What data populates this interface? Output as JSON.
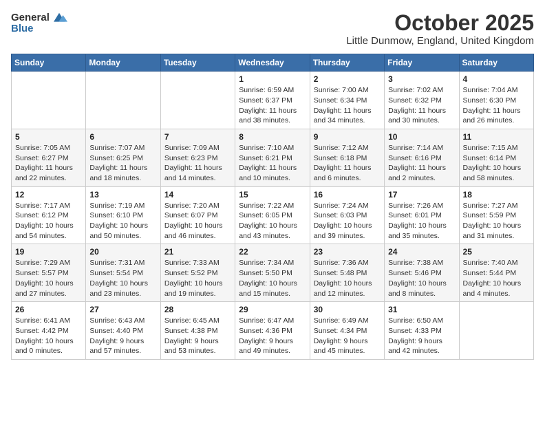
{
  "logo": {
    "general": "General",
    "blue": "Blue"
  },
  "header": {
    "month": "October 2025",
    "location": "Little Dunmow, England, United Kingdom"
  },
  "weekdays": [
    "Sunday",
    "Monday",
    "Tuesday",
    "Wednesday",
    "Thursday",
    "Friday",
    "Saturday"
  ],
  "weeks": [
    [
      {
        "day": "",
        "info": ""
      },
      {
        "day": "",
        "info": ""
      },
      {
        "day": "",
        "info": ""
      },
      {
        "day": "1",
        "info": "Sunrise: 6:59 AM\nSunset: 6:37 PM\nDaylight: 11 hours\nand 38 minutes."
      },
      {
        "day": "2",
        "info": "Sunrise: 7:00 AM\nSunset: 6:34 PM\nDaylight: 11 hours\nand 34 minutes."
      },
      {
        "day": "3",
        "info": "Sunrise: 7:02 AM\nSunset: 6:32 PM\nDaylight: 11 hours\nand 30 minutes."
      },
      {
        "day": "4",
        "info": "Sunrise: 7:04 AM\nSunset: 6:30 PM\nDaylight: 11 hours\nand 26 minutes."
      }
    ],
    [
      {
        "day": "5",
        "info": "Sunrise: 7:05 AM\nSunset: 6:27 PM\nDaylight: 11 hours\nand 22 minutes."
      },
      {
        "day": "6",
        "info": "Sunrise: 7:07 AM\nSunset: 6:25 PM\nDaylight: 11 hours\nand 18 minutes."
      },
      {
        "day": "7",
        "info": "Sunrise: 7:09 AM\nSunset: 6:23 PM\nDaylight: 11 hours\nand 14 minutes."
      },
      {
        "day": "8",
        "info": "Sunrise: 7:10 AM\nSunset: 6:21 PM\nDaylight: 11 hours\nand 10 minutes."
      },
      {
        "day": "9",
        "info": "Sunrise: 7:12 AM\nSunset: 6:18 PM\nDaylight: 11 hours\nand 6 minutes."
      },
      {
        "day": "10",
        "info": "Sunrise: 7:14 AM\nSunset: 6:16 PM\nDaylight: 11 hours\nand 2 minutes."
      },
      {
        "day": "11",
        "info": "Sunrise: 7:15 AM\nSunset: 6:14 PM\nDaylight: 10 hours\nand 58 minutes."
      }
    ],
    [
      {
        "day": "12",
        "info": "Sunrise: 7:17 AM\nSunset: 6:12 PM\nDaylight: 10 hours\nand 54 minutes."
      },
      {
        "day": "13",
        "info": "Sunrise: 7:19 AM\nSunset: 6:10 PM\nDaylight: 10 hours\nand 50 minutes."
      },
      {
        "day": "14",
        "info": "Sunrise: 7:20 AM\nSunset: 6:07 PM\nDaylight: 10 hours\nand 46 minutes."
      },
      {
        "day": "15",
        "info": "Sunrise: 7:22 AM\nSunset: 6:05 PM\nDaylight: 10 hours\nand 43 minutes."
      },
      {
        "day": "16",
        "info": "Sunrise: 7:24 AM\nSunset: 6:03 PM\nDaylight: 10 hours\nand 39 minutes."
      },
      {
        "day": "17",
        "info": "Sunrise: 7:26 AM\nSunset: 6:01 PM\nDaylight: 10 hours\nand 35 minutes."
      },
      {
        "day": "18",
        "info": "Sunrise: 7:27 AM\nSunset: 5:59 PM\nDaylight: 10 hours\nand 31 minutes."
      }
    ],
    [
      {
        "day": "19",
        "info": "Sunrise: 7:29 AM\nSunset: 5:57 PM\nDaylight: 10 hours\nand 27 minutes."
      },
      {
        "day": "20",
        "info": "Sunrise: 7:31 AM\nSunset: 5:54 PM\nDaylight: 10 hours\nand 23 minutes."
      },
      {
        "day": "21",
        "info": "Sunrise: 7:33 AM\nSunset: 5:52 PM\nDaylight: 10 hours\nand 19 minutes."
      },
      {
        "day": "22",
        "info": "Sunrise: 7:34 AM\nSunset: 5:50 PM\nDaylight: 10 hours\nand 15 minutes."
      },
      {
        "day": "23",
        "info": "Sunrise: 7:36 AM\nSunset: 5:48 PM\nDaylight: 10 hours\nand 12 minutes."
      },
      {
        "day": "24",
        "info": "Sunrise: 7:38 AM\nSunset: 5:46 PM\nDaylight: 10 hours\nand 8 minutes."
      },
      {
        "day": "25",
        "info": "Sunrise: 7:40 AM\nSunset: 5:44 PM\nDaylight: 10 hours\nand 4 minutes."
      }
    ],
    [
      {
        "day": "26",
        "info": "Sunrise: 6:41 AM\nSunset: 4:42 PM\nDaylight: 10 hours\nand 0 minutes."
      },
      {
        "day": "27",
        "info": "Sunrise: 6:43 AM\nSunset: 4:40 PM\nDaylight: 9 hours\nand 57 minutes."
      },
      {
        "day": "28",
        "info": "Sunrise: 6:45 AM\nSunset: 4:38 PM\nDaylight: 9 hours\nand 53 minutes."
      },
      {
        "day": "29",
        "info": "Sunrise: 6:47 AM\nSunset: 4:36 PM\nDaylight: 9 hours\nand 49 minutes."
      },
      {
        "day": "30",
        "info": "Sunrise: 6:49 AM\nSunset: 4:34 PM\nDaylight: 9 hours\nand 45 minutes."
      },
      {
        "day": "31",
        "info": "Sunrise: 6:50 AM\nSunset: 4:33 PM\nDaylight: 9 hours\nand 42 minutes."
      },
      {
        "day": "",
        "info": ""
      }
    ]
  ]
}
